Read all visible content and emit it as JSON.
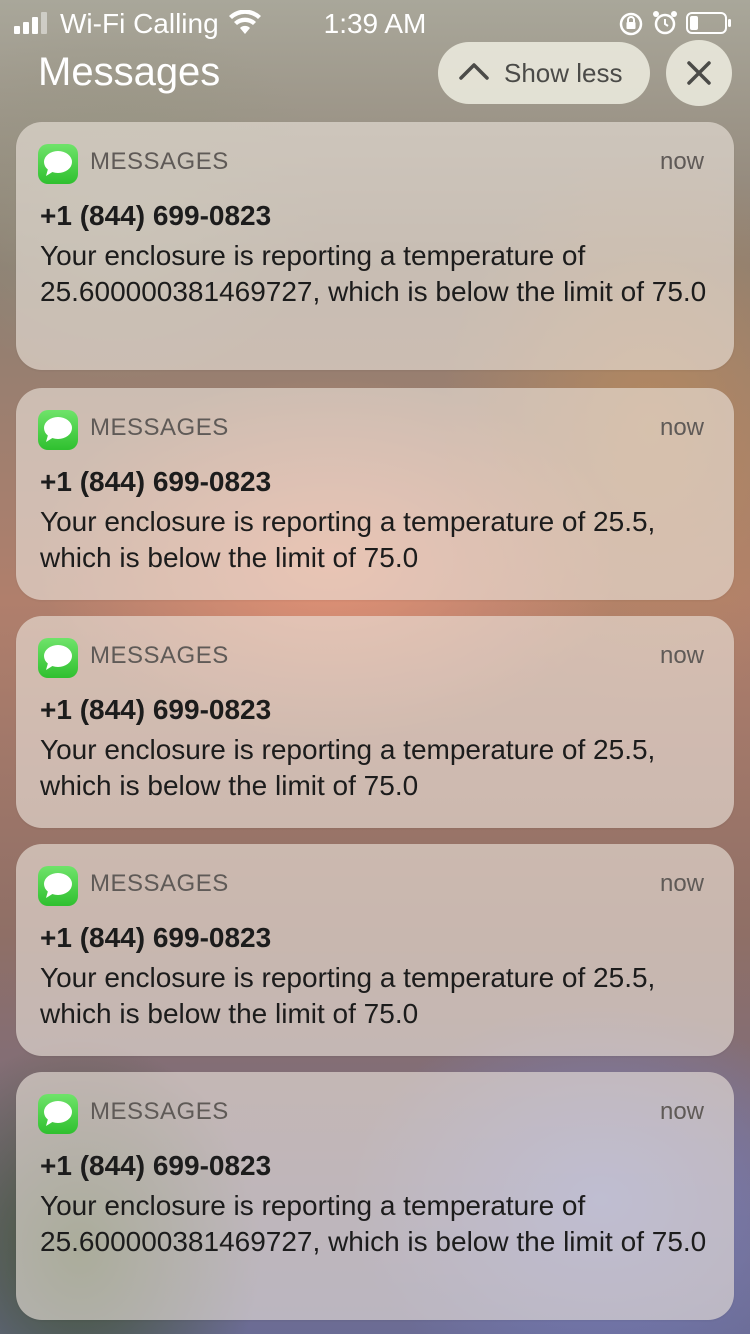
{
  "status_bar": {
    "carrier": "Wi-Fi Calling",
    "time": "1:39 AM"
  },
  "header": {
    "title": "Messages",
    "show_less_label": "Show less"
  },
  "notifications": [
    {
      "app_name": "MESSAGES",
      "time": "now",
      "sender": "+1 (844) 699-0823",
      "body": "Your enclosure is reporting a temperature of 25.600000381469727, which is below the limit of 75.0"
    },
    {
      "app_name": "MESSAGES",
      "time": "now",
      "sender": "+1 (844) 699-0823",
      "body": "Your enclosure is reporting a temperature of 25.5, which is below the limit of 75.0"
    },
    {
      "app_name": "MESSAGES",
      "time": "now",
      "sender": "+1 (844) 699-0823",
      "body": "Your enclosure is reporting a temperature of 25.5, which is below the limit of 75.0"
    },
    {
      "app_name": "MESSAGES",
      "time": "now",
      "sender": "+1 (844) 699-0823",
      "body": "Your enclosure is reporting a temperature of 25.5, which is below the limit of 75.0"
    },
    {
      "app_name": "MESSAGES",
      "time": "now",
      "sender": "+1 (844) 699-0823",
      "body": "Your enclosure is reporting a temperature of 25.600000381469727, which is below the limit of 75.0"
    }
  ],
  "icons": {
    "signal": "signal-bars-icon",
    "wifi": "wifi-icon",
    "rotation_lock": "rotation-lock-icon",
    "alarm": "alarm-icon",
    "battery": "battery-icon",
    "chevron": "chevron-up-icon",
    "close": "close-icon",
    "app": "messages-app-icon"
  },
  "colors": {
    "app_icon_green": "#34c759",
    "pill_background": "#eceade"
  }
}
